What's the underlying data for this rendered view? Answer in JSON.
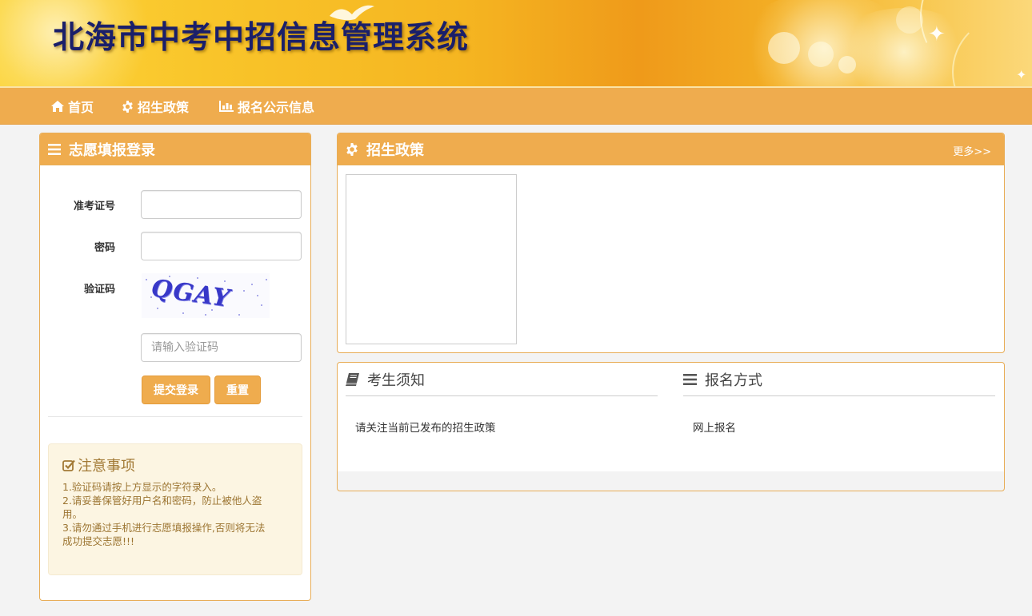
{
  "header": {
    "title": "北海市中考中招信息管理系统"
  },
  "nav": {
    "items": [
      {
        "label": "首页",
        "icon": "home-icon"
      },
      {
        "label": "招生政策",
        "icon": "gear-icon"
      },
      {
        "label": "报名公示信息",
        "icon": "bar-chart-icon"
      }
    ]
  },
  "login": {
    "title": "志愿填报登录",
    "icon": "list-icon",
    "exam_id_label": "准考证号",
    "exam_id_value": "",
    "password_label": "密码",
    "password_value": "",
    "captcha_label": "验证码",
    "captcha_image_text": "QGAY",
    "captcha_input_placeholder": "请输入验证码",
    "submit_label": "提交登录",
    "reset_label": "重置"
  },
  "notice": {
    "title": "注意事项",
    "icon": "check-square-icon",
    "lines": [
      "1.验证码请按上方显示的字符录入。",
      "2.请妥善保管好用户名和密码，防止被他人盗",
      "用。",
      "3.请勿通过手机进行志愿填报操作,否则将无法",
      "成功提交志愿!!!"
    ]
  },
  "policy": {
    "title": "招生政策",
    "icon": "gear-icon",
    "more_label": "更多>>"
  },
  "info": {
    "guide_title": "考生须知",
    "guide_icon": "book-icon",
    "guide_text": "请关注当前已发布的招生政策",
    "method_title": "报名方式",
    "method_icon": "list-icon",
    "method_text": "网上报名"
  },
  "colors": {
    "accent": "#efac4e",
    "title_text": "#1a1f6a",
    "notice_bg": "#fcf5e2",
    "notice_text": "#9c7532"
  }
}
